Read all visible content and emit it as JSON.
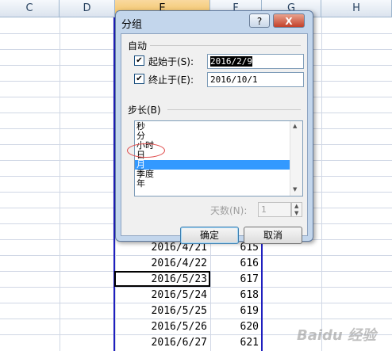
{
  "spreadsheet": {
    "columns": [
      "C",
      "D",
      "E",
      "F",
      "G",
      "H"
    ],
    "selected_column": "E",
    "rows": [
      {
        "date": "2016/4/21",
        "value": "615"
      },
      {
        "date": "2016/4/22",
        "value": "616"
      },
      {
        "date": "2016/5/23",
        "value": "617"
      },
      {
        "date": "2016/5/24",
        "value": "618"
      },
      {
        "date": "2016/5/25",
        "value": "619"
      },
      {
        "date": "2016/5/26",
        "value": "620"
      },
      {
        "date": "2016/6/27",
        "value": "621"
      }
    ]
  },
  "dialog": {
    "title": "分组",
    "help_label": "?",
    "close_label": "X",
    "auto_group_label": "自动",
    "start": {
      "label": "起始于(S):",
      "checked": true,
      "value": "2016/2/9"
    },
    "end": {
      "label": "终止于(E):",
      "checked": true,
      "value": "2016/10/1"
    },
    "step_group_label": "步长(B)",
    "step_options": [
      "秒",
      "分",
      "小时",
      "日",
      "月",
      "季度",
      "年"
    ],
    "selected_option": "月",
    "days_label": "天数(N):",
    "days_value": "1",
    "ok_label": "确定",
    "cancel_label": "取消"
  },
  "watermark": "Baidu 经验"
}
